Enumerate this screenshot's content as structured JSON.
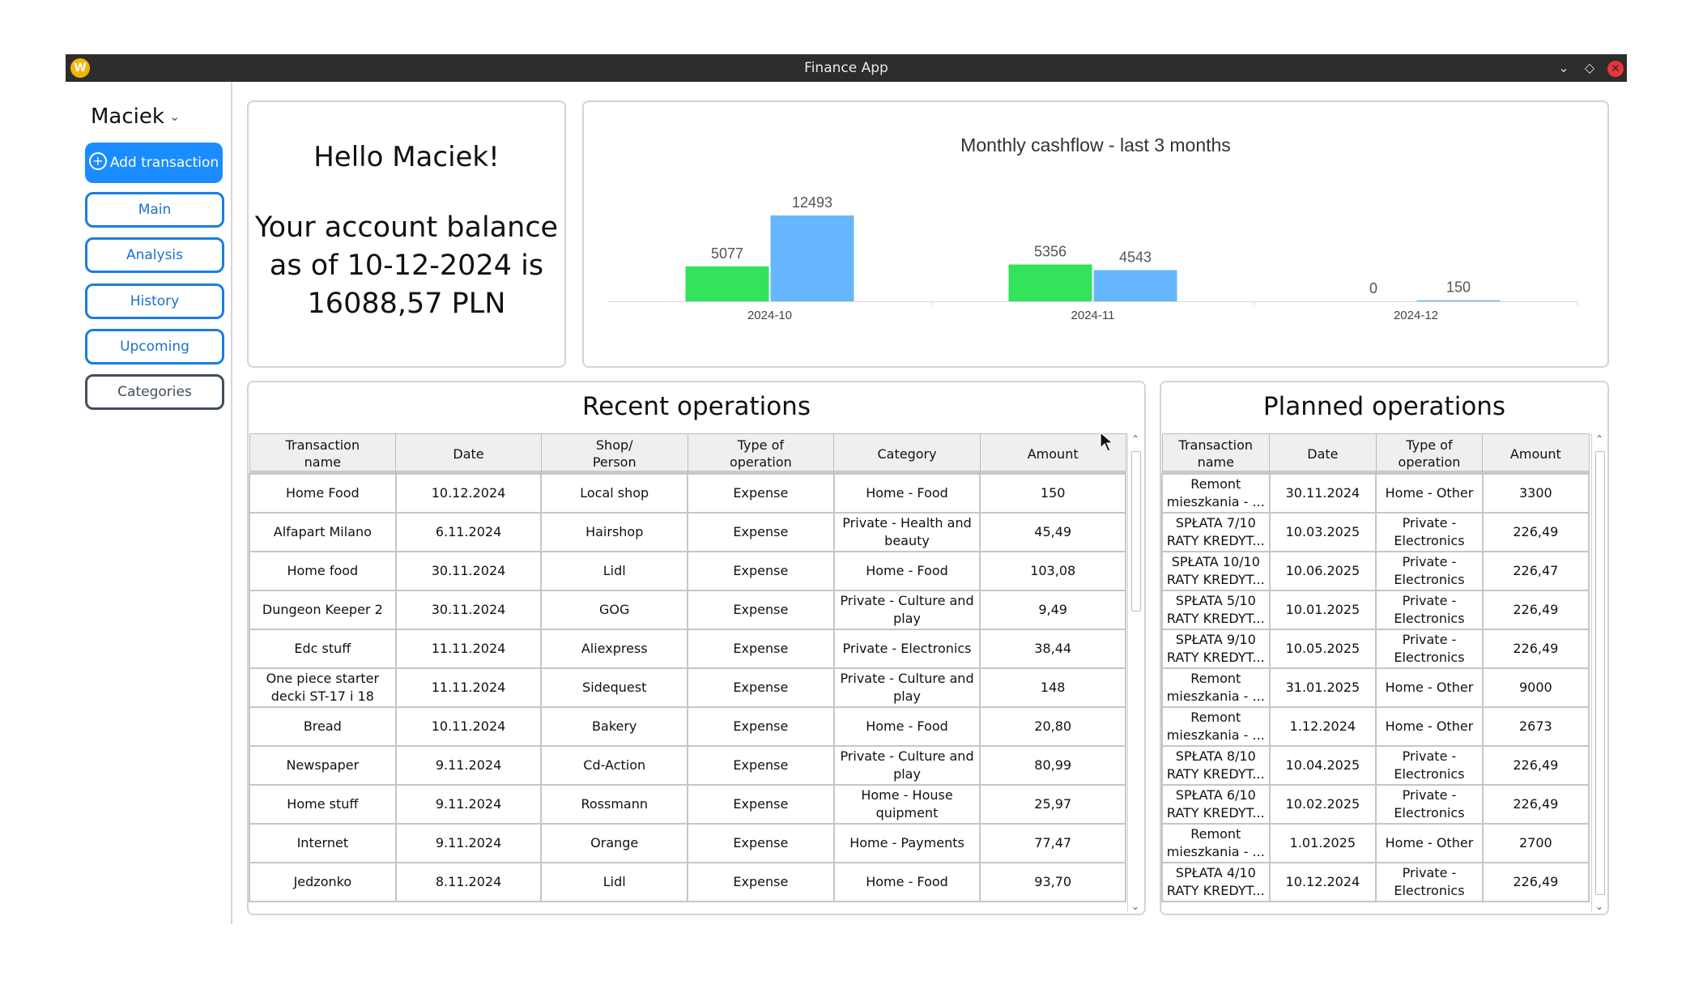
{
  "window": {
    "title": "Finance App",
    "app_icon": "W"
  },
  "sidebar": {
    "user": "Maciek",
    "add_transaction": "Add transaction",
    "nav": [
      "Main",
      "Analysis",
      "History",
      "Upcoming",
      "Categories"
    ]
  },
  "greeting": {
    "hello": "Hello Maciek!",
    "balance_line1": "Your account balance",
    "balance_line2": "as of 10-12-2024 is",
    "balance_line3": "16088,57 PLN"
  },
  "chart_data": {
    "type": "bar",
    "title": "Monthly cashflow - last 3 months",
    "categories": [
      "2024-10",
      "2024-11",
      "2024-12"
    ],
    "series": [
      {
        "values": [
          5077,
          5356,
          0
        ],
        "color": "#33e35c"
      },
      {
        "values": [
          12493,
          4543,
          150
        ],
        "color": "#66b7ff"
      }
    ],
    "ylim": [
      0,
      12493
    ]
  },
  "recent": {
    "title": "Recent operations",
    "columns": [
      "Transaction\nname",
      "Date",
      "Shop/\nPerson",
      "Type of\noperation",
      "Category",
      "Amount"
    ],
    "rows": [
      [
        "Home Food",
        "10.12.2024",
        "Local shop",
        "Expense",
        "Home - Food",
        "150"
      ],
      [
        "Alfapart Milano",
        "6.11.2024",
        "Hairshop",
        "Expense",
        "Private - Health and\nbeauty",
        "45,49"
      ],
      [
        "Home food",
        "30.11.2024",
        "Lidl",
        "Expense",
        "Home - Food",
        "103,08"
      ],
      [
        "Dungeon Keeper 2",
        "30.11.2024",
        "GOG",
        "Expense",
        "Private - Culture and\nplay",
        "9,49"
      ],
      [
        "Edc stuff",
        "11.11.2024",
        "Aliexpress",
        "Expense",
        "Private - Electronics",
        "38,44"
      ],
      [
        "One piece starter\ndecki ST-17 i 18",
        "11.11.2024",
        "Sidequest",
        "Expense",
        "Private - Culture and\nplay",
        "148"
      ],
      [
        "Bread",
        "10.11.2024",
        "Bakery",
        "Expense",
        "Home - Food",
        "20,80"
      ],
      [
        "Newspaper",
        "9.11.2024",
        "Cd-Action",
        "Expense",
        "Private - Culture and\nplay",
        "80,99"
      ],
      [
        "Home stuff",
        "9.11.2024",
        "Rossmann",
        "Expense",
        "Home - House\nquipment",
        "25,97"
      ],
      [
        "Internet",
        "9.11.2024",
        "Orange",
        "Expense",
        "Home - Payments",
        "77,47"
      ],
      [
        "Jedzonko",
        "8.11.2024",
        "Lidl",
        "Expense",
        "Home - Food",
        "93,70"
      ]
    ]
  },
  "planned": {
    "title": "Planned operations",
    "columns": [
      "Transaction\nname",
      "Date",
      "Type of\noperation",
      "Amount"
    ],
    "rows": [
      [
        "Remont\nmieszkania - ...",
        "30.11.2024",
        "Home - Other",
        "3300"
      ],
      [
        "SPŁATA 7/10\nRATY KREDYT...",
        "10.03.2025",
        "Private -\nElectronics",
        "226,49"
      ],
      [
        "SPŁATA 10/10\nRATY KREDYT...",
        "10.06.2025",
        "Private -\nElectronics",
        "226,47"
      ],
      [
        "SPŁATA 5/10\nRATY KREDYT...",
        "10.01.2025",
        "Private -\nElectronics",
        "226,49"
      ],
      [
        "SPŁATA 9/10\nRATY KREDYT...",
        "10.05.2025",
        "Private -\nElectronics",
        "226,49"
      ],
      [
        "Remont\nmieszkania - ...",
        "31.01.2025",
        "Home - Other",
        "9000"
      ],
      [
        "Remont\nmieszkania - ...",
        "1.12.2024",
        "Home - Other",
        "2673"
      ],
      [
        "SPŁATA 8/10\nRATY KREDYT...",
        "10.04.2025",
        "Private -\nElectronics",
        "226,49"
      ],
      [
        "SPŁATA 6/10\nRATY KREDYT...",
        "10.02.2025",
        "Private -\nElectronics",
        "226,49"
      ],
      [
        "Remont\nmieszkania - ...",
        "1.01.2025",
        "Home - Other",
        "2700"
      ],
      [
        "SPŁATA 4/10\nRATY KREDYT...",
        "10.12.2024",
        "Private -\nElectronics",
        "226,49"
      ]
    ]
  }
}
